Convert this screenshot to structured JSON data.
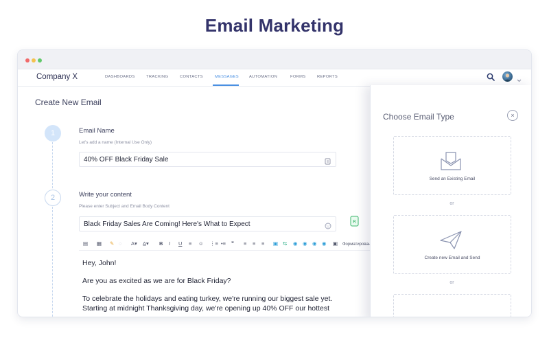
{
  "page": {
    "heading": "Email Marketing"
  },
  "window_controls": {
    "colors": [
      "#f16a6a",
      "#f4c24f",
      "#62c96b"
    ]
  },
  "app": {
    "brand": "Company X",
    "nav": [
      {
        "label": "DASHBOARDS",
        "active": false
      },
      {
        "label": "TRACKING",
        "active": false
      },
      {
        "label": "CONTACTS",
        "active": false
      },
      {
        "label": "MESSAGES",
        "active": true
      },
      {
        "label": "AUTOMATION",
        "active": false
      },
      {
        "label": "FORMS",
        "active": false
      },
      {
        "label": "REPORTS",
        "active": false
      }
    ],
    "accent_color": "#4a90e2"
  },
  "create": {
    "title": "Create New Email",
    "steps": [
      {
        "number": "1",
        "label": "Email Name",
        "hint": "Let's add a name (Internal Use Only)",
        "value": "40% OFF Black Friday Sale"
      },
      {
        "number": "2",
        "label": "Write your content",
        "hint": "Please enter Subject and Email Body Content",
        "subject": "Black Friday Sales Are Coming! Here's What to Expect"
      }
    ],
    "toolbar": {
      "items": [
        "▤",
        "▦",
        "✎",
        "◌",
        "A▾",
        "A̲▾",
        "B",
        "I",
        "U",
        "≡",
        "☺",
        "⋮≡",
        "•≡",
        "❞",
        "≡",
        "≡",
        "≡",
        "▣",
        "⇆",
        "◉",
        "◉",
        "◉",
        "◉",
        "▣"
      ],
      "format_label": "Форматирован"
    },
    "body_lines": [
      "Hey, John!",
      "Are you as excited as we are for Black Friday?",
      "To celebrate the holidays and eating turkey, we're running our biggest sale yet.",
      "Starting at midnight Thanksgiving day, we're opening up 40% OFF our hottest"
    ]
  },
  "side_panel": {
    "title": "Choose Email Type",
    "close_symbol": "×",
    "options": [
      {
        "label": "Send an Existing Email",
        "icon": "envelope-icon"
      },
      {
        "label": "Create new Email and Send",
        "icon": "paper-plane-icon"
      },
      {
        "label": "",
        "icon": "template-icon"
      }
    ],
    "separator": "or"
  }
}
